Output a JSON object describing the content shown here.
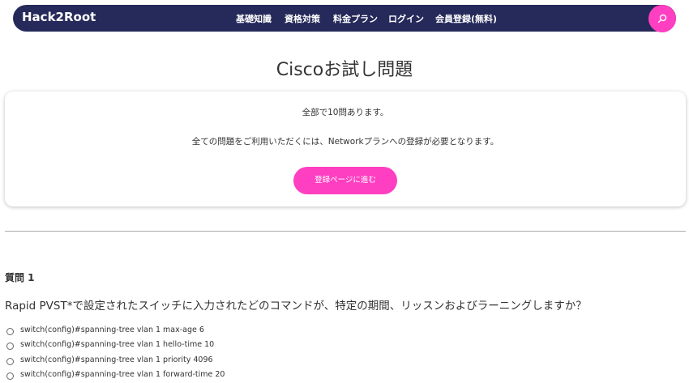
{
  "header": {
    "logo": "Hack2Root",
    "nav": [
      "基礎知識",
      "資格対策",
      "料金プラン",
      "ログイン",
      "会員登録(無料)"
    ],
    "search_icon": "search-icon",
    "bar_color": "#262a5a",
    "accent": "#ff3fc1"
  },
  "page": {
    "title": "Ciscoお試し問題"
  },
  "info_card": {
    "line1": "全部で10問あります。",
    "line2": "全ての問題をご利用いただくには、Networkプランへの登録が必要となります。",
    "button_label": "登録ページに進む"
  },
  "question": {
    "heading": "質問 1",
    "text": "Rapid PVST*で設定されたスイッチに入力されたどのコマンドが、特定の期間、リッスンおよびラーニングしますか？",
    "options": [
      "switch(config)#spanning-tree vlan 1 max-age 6",
      "switch(config)#spanning-tree vlan 1 hello-time 10",
      "switch(config)#spanning-tree vlan 1 priority 4096",
      "switch(config)#spanning-tree vlan 1 forward-time 20"
    ]
  }
}
